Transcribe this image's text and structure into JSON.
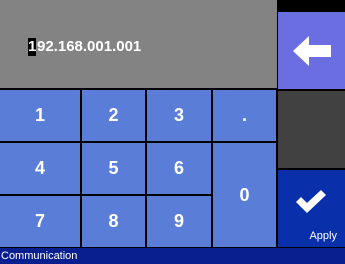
{
  "display": {
    "first_char": "1",
    "rest": "92.168.001.001"
  },
  "keypad": {
    "k1": "1",
    "k2": "2",
    "k3": "3",
    "kdot": ".",
    "k4": "4",
    "k5": "5",
    "k6": "6",
    "k0": "0",
    "k7": "7",
    "k8": "8",
    "k9": "9"
  },
  "actions": {
    "apply_label": "Apply"
  },
  "status": {
    "text": "Communication"
  },
  "colors": {
    "key": "#5a7ed8",
    "backspace": "#6b6ee0",
    "apply": "#0a2faa",
    "display": "#838383",
    "status_bar": "#0a1f8f"
  },
  "icons": {
    "backspace": "arrow-left-icon",
    "apply": "check-icon"
  }
}
